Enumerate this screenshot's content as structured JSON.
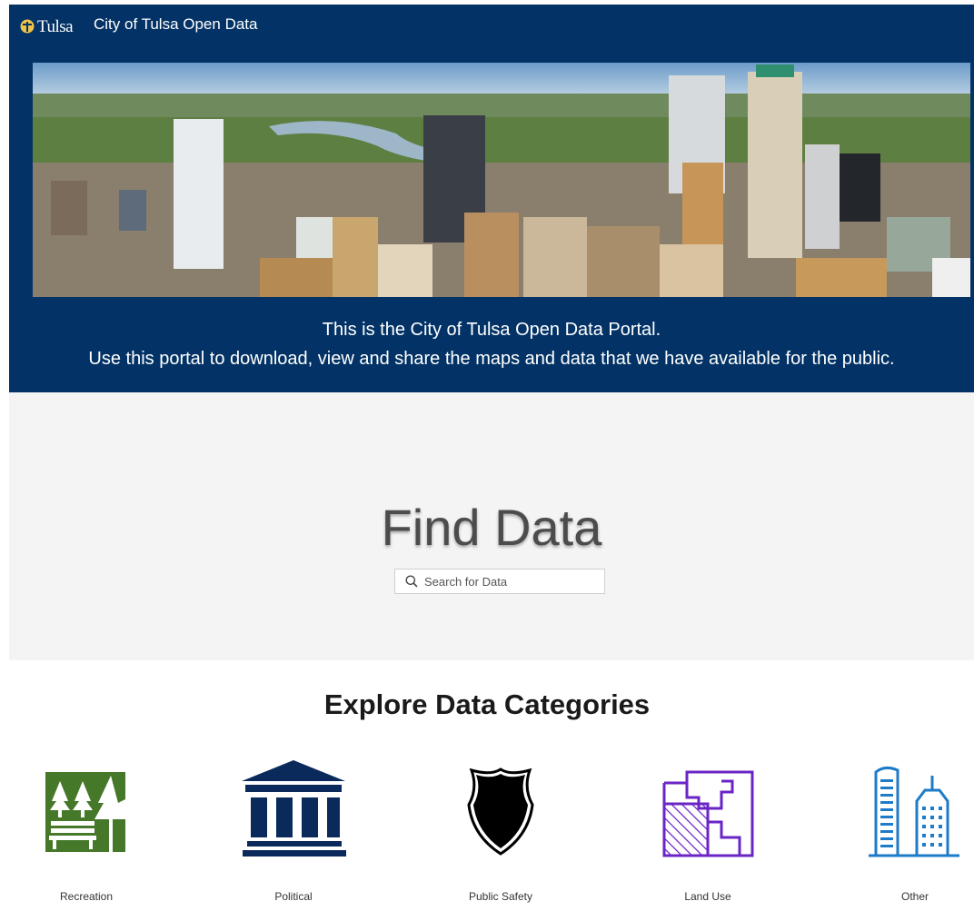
{
  "header": {
    "logo_text": "Tulsa",
    "site_title": "City of Tulsa Open Data"
  },
  "hero": {
    "intro_line1": "This is the City of Tulsa Open Data Portal.",
    "intro_line2": "Use this portal to download, view and share the maps and data that we have available for the public."
  },
  "find": {
    "title": "Find Data",
    "search_placeholder": "Search for Data"
  },
  "categories": {
    "title": "Explore Data Categories",
    "items": [
      {
        "label": "Recreation",
        "icon": "park-bench-trees-icon",
        "color": "#46782a"
      },
      {
        "label": "Political",
        "icon": "government-building-icon",
        "color": "#0b2a5c"
      },
      {
        "label": "Public Safety",
        "icon": "police-badge-icon",
        "color": "#000000"
      },
      {
        "label": "Land Use",
        "icon": "parcel-map-icon",
        "color": "#6b24c6"
      },
      {
        "label": "Other",
        "icon": "skyscrapers-icon",
        "color": "#1e7bc8"
      }
    ]
  },
  "colors": {
    "header_bg": "#033366",
    "find_bg": "#f4f4f4"
  }
}
